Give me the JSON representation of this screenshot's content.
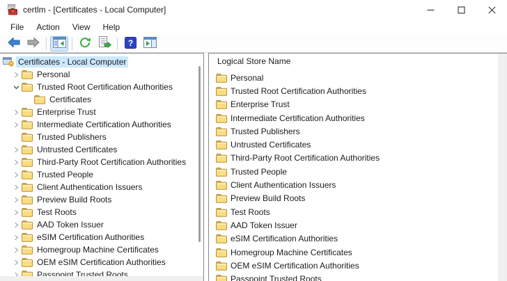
{
  "window": {
    "title": "certlm - [Certificates - Local Computer]"
  },
  "menu": {
    "items": [
      "File",
      "Action",
      "View",
      "Help"
    ]
  },
  "toolbar": {
    "buttons": [
      {
        "name": "back",
        "icon": "back-arrow-icon",
        "active": false
      },
      {
        "name": "forward",
        "icon": "forward-arrow-icon",
        "active": false
      },
      {
        "sep": true
      },
      {
        "name": "show-console-tree",
        "icon": "console-tree-icon",
        "active": true
      },
      {
        "sep": true
      },
      {
        "name": "refresh",
        "icon": "refresh-icon",
        "active": false
      },
      {
        "name": "export-list",
        "icon": "export-list-icon",
        "active": false
      },
      {
        "sep": true
      },
      {
        "name": "help",
        "icon": "help-icon",
        "active": false
      },
      {
        "name": "show-action-pane",
        "icon": "action-pane-icon",
        "active": false
      }
    ]
  },
  "tree": {
    "items": [
      {
        "label": "Certificates - Local Computer",
        "level": 0,
        "expander": "none",
        "icon": "certificates-root-icon",
        "selected": true
      },
      {
        "label": "Personal",
        "level": 1,
        "expander": "collapsed",
        "icon": "folder-icon",
        "selected": false
      },
      {
        "label": "Trusted Root Certification Authorities",
        "level": 1,
        "expander": "expanded",
        "icon": "folder-icon",
        "selected": false
      },
      {
        "label": "Certificates",
        "level": 2,
        "expander": "none",
        "icon": "folder-icon",
        "selected": false
      },
      {
        "label": "Enterprise Trust",
        "level": 1,
        "expander": "collapsed",
        "icon": "folder-icon",
        "selected": false
      },
      {
        "label": "Intermediate Certification Authorities",
        "level": 1,
        "expander": "collapsed",
        "icon": "folder-icon",
        "selected": false
      },
      {
        "label": "Trusted Publishers",
        "level": 1,
        "expander": "none",
        "icon": "folder-icon",
        "selected": false
      },
      {
        "label": "Untrusted Certificates",
        "level": 1,
        "expander": "collapsed",
        "icon": "folder-icon",
        "selected": false
      },
      {
        "label": "Third-Party Root Certification Authorities",
        "level": 1,
        "expander": "collapsed",
        "icon": "folder-icon",
        "selected": false
      },
      {
        "label": "Trusted People",
        "level": 1,
        "expander": "collapsed",
        "icon": "folder-icon",
        "selected": false
      },
      {
        "label": "Client Authentication Issuers",
        "level": 1,
        "expander": "collapsed",
        "icon": "folder-icon",
        "selected": false
      },
      {
        "label": "Preview Build Roots",
        "level": 1,
        "expander": "collapsed",
        "icon": "folder-icon",
        "selected": false
      },
      {
        "label": "Test Roots",
        "level": 1,
        "expander": "collapsed",
        "icon": "folder-icon",
        "selected": false
      },
      {
        "label": "AAD Token Issuer",
        "level": 1,
        "expander": "collapsed",
        "icon": "folder-icon",
        "selected": false
      },
      {
        "label": "eSIM Certification Authorities",
        "level": 1,
        "expander": "collapsed",
        "icon": "folder-icon",
        "selected": false
      },
      {
        "label": "Homegroup Machine Certificates",
        "level": 1,
        "expander": "collapsed",
        "icon": "folder-icon",
        "selected": false
      },
      {
        "label": "OEM eSIM Certification Authorities",
        "level": 1,
        "expander": "collapsed",
        "icon": "folder-icon",
        "selected": false
      },
      {
        "label": "Passpoint Trusted Roots",
        "level": 1,
        "expander": "collapsed",
        "icon": "folder-icon",
        "selected": false
      }
    ]
  },
  "list": {
    "header": "Logical Store Name",
    "items": [
      "Personal",
      "Trusted Root Certification Authorities",
      "Enterprise Trust",
      "Intermediate Certification Authorities",
      "Trusted Publishers",
      "Untrusted Certificates",
      "Third-Party Root Certification Authorities",
      "Trusted People",
      "Client Authentication Issuers",
      "Preview Build Roots",
      "Test Roots",
      "AAD Token Issuer",
      "eSIM Certification Authorities",
      "Homegroup Machine Certificates",
      "OEM eSIM Certification Authorities",
      "Passpoint Trusted Roots"
    ]
  },
  "colors": {
    "selection": "#cce8ff",
    "back_arrow_blue": "#3f83d6",
    "forward_arrow_gray": "#a9a9a9",
    "folder_yellow": "#f9dd82",
    "help_blue": "#2f44c2",
    "toolbar_active_bg": "#d6eafc",
    "pane_border": "#828790"
  }
}
